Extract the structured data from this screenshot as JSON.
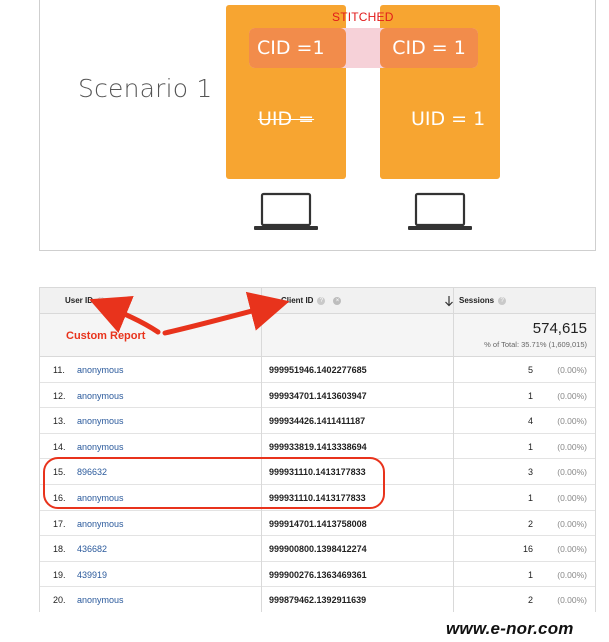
{
  "diagram": {
    "scenario_label": "Scenario 1",
    "stitched_label": "STITCHED",
    "left_device": {
      "cid": "CID =1",
      "uid": "UID ="
    },
    "right_device": {
      "cid": "CID = 1",
      "uid": "UID = 1"
    },
    "colors": {
      "device_fill": "#f7a531",
      "cid_chip": "#f28c4b",
      "stitch_band": "#f6d1d8",
      "stitched_text": "#e21b1b"
    }
  },
  "report": {
    "headers": {
      "user_id": "User ID",
      "client_id": "Client ID",
      "sessions": "Sessions"
    },
    "annotation": "Custom Report",
    "totals": {
      "value": "574,615",
      "sub": "% of Total: 35.71% (1,609,015)"
    },
    "rows": [
      {
        "idx": "11.",
        "user_id": "anonymous",
        "client_id": "999951946.1402277685",
        "sessions": "5",
        "pct": "(0.00%)"
      },
      {
        "idx": "12.",
        "user_id": "anonymous",
        "client_id": "999934701.1413603947",
        "sessions": "1",
        "pct": "(0.00%)"
      },
      {
        "idx": "13.",
        "user_id": "anonymous",
        "client_id": "999934426.1411411187",
        "sessions": "4",
        "pct": "(0.00%)"
      },
      {
        "idx": "14.",
        "user_id": "anonymous",
        "client_id": "999933819.1413338694",
        "sessions": "1",
        "pct": "(0.00%)"
      },
      {
        "idx": "15.",
        "user_id": "896632",
        "client_id": "999931110.1413177833",
        "sessions": "3",
        "pct": "(0.00%)"
      },
      {
        "idx": "16.",
        "user_id": "anonymous",
        "client_id": "999931110.1413177833",
        "sessions": "1",
        "pct": "(0.00%)"
      },
      {
        "idx": "17.",
        "user_id": "anonymous",
        "client_id": "999914701.1413758008",
        "sessions": "2",
        "pct": "(0.00%)"
      },
      {
        "idx": "18.",
        "user_id": "436682",
        "client_id": "999900800.1398412274",
        "sessions": "16",
        "pct": "(0.00%)"
      },
      {
        "idx": "19.",
        "user_id": "439919",
        "client_id": "999900276.1363469361",
        "sessions": "1",
        "pct": "(0.00%)"
      },
      {
        "idx": "20.",
        "user_id": "anonymous",
        "client_id": "999879462.1392911639",
        "sessions": "2",
        "pct": "(0.00%)"
      }
    ],
    "colors": {
      "link": "#2b5a9c",
      "annotation": "#e8331c",
      "header_bg": "#f1f1f1"
    }
  },
  "watermark": "www.e-nor.com"
}
